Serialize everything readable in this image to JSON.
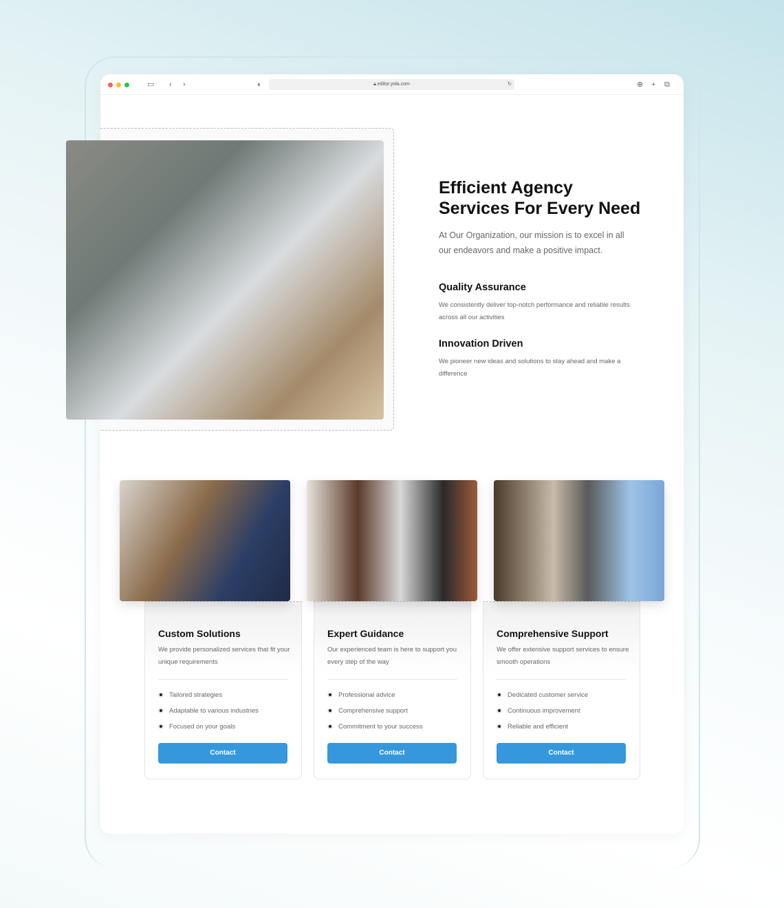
{
  "browser": {
    "url": "editor.yola.com"
  },
  "hero": {
    "title_line1": "Efficient Agency",
    "title_line2": "Services For Every Need",
    "lead": "At Our Organization, our mission is to excel in all our endeavors and make a positive impact.",
    "features": [
      {
        "title": "Quality Assurance",
        "text": "We consistently deliver top-notch performance and reliable results across all our activities"
      },
      {
        "title": "Innovation Driven",
        "text": "We pioneer new ideas and solutions to stay ahead and make a difference"
      }
    ]
  },
  "cards": [
    {
      "title": "Custom Solutions",
      "text": "We provide personalized services that fit your unique requirements",
      "items": [
        "Tailored strategies",
        "Adaptable to various industries",
        "Focused on your goals"
      ],
      "button": "Contact"
    },
    {
      "title": "Expert Guidance",
      "text": "Our experienced team is here to support you every step of the way",
      "items": [
        "Professional advice",
        "Comprehensive support",
        "Commitment to your success"
      ],
      "button": "Contact"
    },
    {
      "title": "Comprehensive Support",
      "text": "We offer extensive support services to ensure smooth operations",
      "items": [
        "Dedicated customer service",
        "Continuous improvement",
        "Reliable and efficient"
      ],
      "button": "Contact"
    }
  ],
  "colors": {
    "accent": "#3598dc"
  }
}
